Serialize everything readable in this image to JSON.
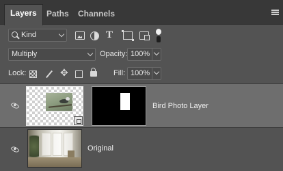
{
  "tabs": [
    {
      "label": "Layers",
      "active": true
    },
    {
      "label": "Paths",
      "active": false
    },
    {
      "label": "Channels",
      "active": false
    }
  ],
  "filter": {
    "kind_label": "Kind",
    "icons": [
      "pixel-layer-filter-icon",
      "adjustment-layer-filter-icon",
      "type-layer-filter-icon",
      "shape-layer-filter-icon",
      "smart-object-filter-icon",
      "filter-toggle-icon"
    ]
  },
  "blend": {
    "mode": "Multiply",
    "opacity_label": "Opacity:",
    "opacity_value": "100%"
  },
  "lock": {
    "label": "Lock:",
    "icons": [
      "lock-transparent-pixels-icon",
      "lock-image-pixels-icon",
      "lock-position-icon",
      "lock-artboard-icon",
      "lock-all-icon"
    ],
    "fill_label": "Fill:",
    "fill_value": "100%"
  },
  "layers": [
    {
      "name": "Bird Photo Layer",
      "selected": true,
      "visible": true,
      "has_mask": true,
      "smart_object": true
    },
    {
      "name": "Original",
      "selected": false,
      "visible": true,
      "has_mask": false,
      "smart_object": false
    }
  ],
  "colors": {
    "panel_bg": "#535353",
    "tabbar_bg": "#383838",
    "selected_row": "#6e6e6e"
  }
}
